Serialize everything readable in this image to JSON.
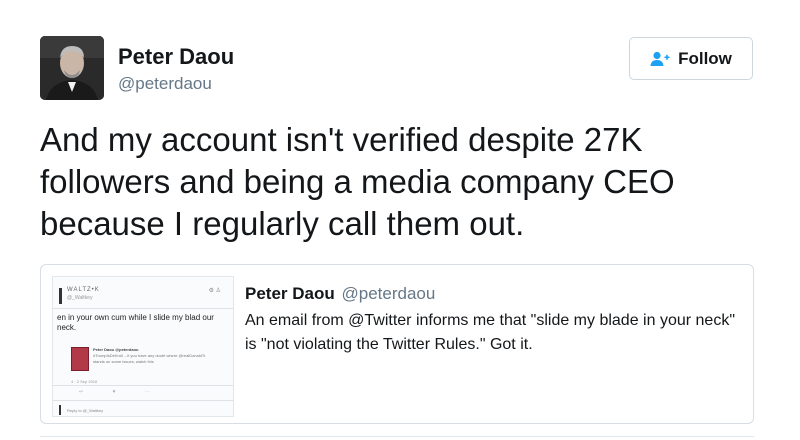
{
  "author": {
    "name": "Peter Daou",
    "handle": "@peterdaou"
  },
  "follow_button": {
    "label": "Follow",
    "icon": "add-user-icon"
  },
  "tweet": {
    "text": "And my account isn't verified despite 27K followers and being a media company CEO because I regularly call them out."
  },
  "quoted_tweet": {
    "author_name": "Peter Daou",
    "author_handle": "@peterdaou",
    "text": "An email from @Twitter informs me that \"slide my blade in your neck\" is \"not violating the Twitter Rules.\" Got it.",
    "thumbnail": {
      "header_text": "WALTZ•K",
      "header_sub": "@_Waltkey",
      "snippet": "en in your own cum while I slide my blad our neck.",
      "mini_name": "Peter Daou @peterdaou",
      "mini_line_1": "#TrumpIsDeKroll ...if you have any doubt where @realDonaldTr",
      "mini_line_2": "stands on some issues, watch this",
      "mini_date": "4 · 2 Sep 2016",
      "reply_text": "Reply to @_Waltkey"
    }
  },
  "colors": {
    "text": "#14171a",
    "secondary_text": "#657786",
    "border": "#ccd6dd",
    "follow_icon": "#1da1f2"
  }
}
